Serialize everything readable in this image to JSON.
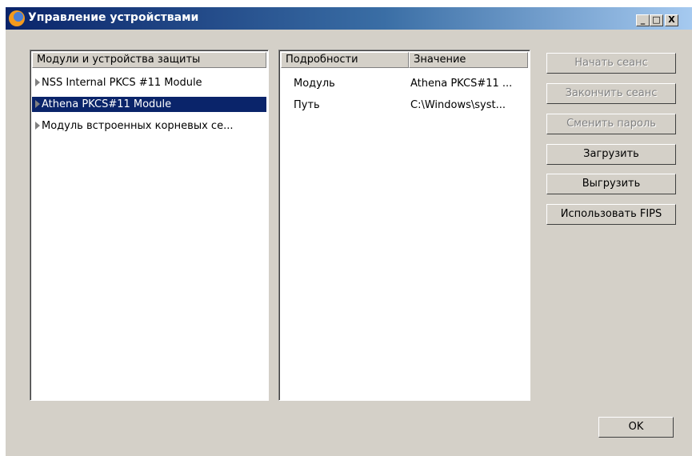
{
  "window": {
    "title": "Управление устройствами",
    "controls": {
      "minimize": "_",
      "maximize": "□",
      "close": "X"
    }
  },
  "modules_panel": {
    "header": "Модули и устройства защиты",
    "items": [
      {
        "label": "NSS Internal PKCS #11 Module",
        "selected": false
      },
      {
        "label": "Athena PKCS#11 Module",
        "selected": true
      },
      {
        "label": "Модуль встроенных корневых се...",
        "selected": false
      }
    ]
  },
  "details_panel": {
    "headers": [
      "Подробности",
      "Значение"
    ],
    "rows": [
      {
        "name": "Модуль",
        "value": "Athena PKCS#11 ..."
      },
      {
        "name": "Путь",
        "value": "C:\\Windows\\syst..."
      }
    ]
  },
  "buttons": {
    "start_session": "Начать сеанс",
    "end_session": "Закончить сеанс",
    "change_password": "Сменить пароль",
    "load": "Загрузить",
    "unload": "Выгрузить",
    "use_fips": "Использовать FIPS",
    "ok": "OK"
  },
  "colors": {
    "selection": "#0a246a",
    "dialog": "#d4d0c8"
  }
}
